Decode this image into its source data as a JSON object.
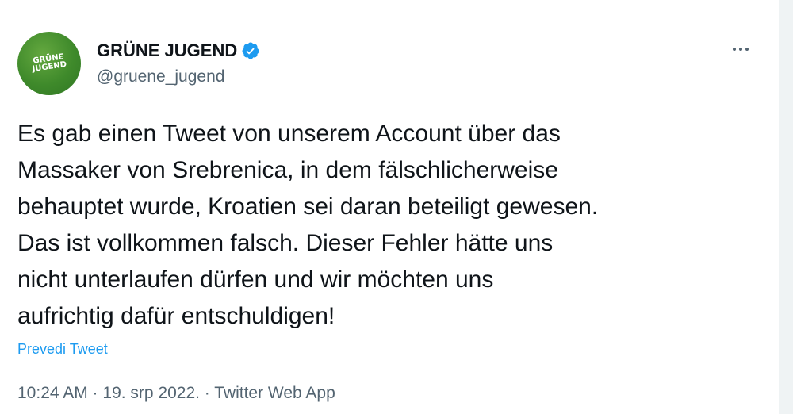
{
  "author": {
    "avatar_text": "GRÜNE\nJUGEND",
    "display_name": "GRÜNE JUGEND",
    "handle": "@gruene_jugend",
    "verified": true
  },
  "colors": {
    "avatar_green": "#3f8a2b",
    "verified_blue": "#1d9bf0",
    "link_blue": "#1d9bf0",
    "text_primary": "#0f1419",
    "text_secondary": "#536471"
  },
  "icons": {
    "verified": "verified-badge-icon",
    "more": "more-options-icon"
  },
  "tweet": {
    "lines": [
      "Es gab einen Tweet von unserem Account über das",
      "Massaker von Srebrenica, in dem fälschlicherweise",
      "behauptet wurde, Kroatien sei daran beteiligt gewesen.",
      "Das ist vollkommen falsch. Dieser Fehler hätte uns",
      "nicht unterlaufen dürfen und wir möchten uns",
      "aufrichtig dafür entschuldigen!"
    ],
    "translate_label": "Prevedi Tweet",
    "timestamp": "10:24 AM · 19. srp 2022. · Twitter Web App"
  }
}
